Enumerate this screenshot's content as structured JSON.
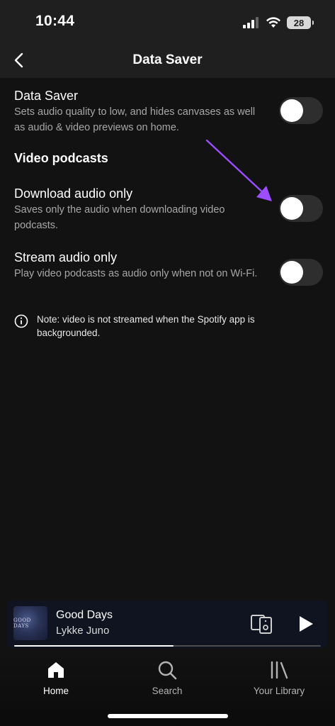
{
  "status_bar": {
    "time": "10:44",
    "battery": "28"
  },
  "header": {
    "title": "Data Saver",
    "back_icon": "chevron-left-icon"
  },
  "settings": [
    {
      "title": "Data Saver",
      "description": "Sets audio quality to low, and hides canvases as well as audio & video previews on home.",
      "enabled": false
    }
  ],
  "video_podcasts": {
    "heading": "Video podcasts",
    "items": [
      {
        "title": "Download audio only",
        "description": "Saves only the audio when downloading video podcasts.",
        "enabled": false
      },
      {
        "title": "Stream audio only",
        "description": "Play video podcasts as audio only when not on Wi-Fi.",
        "enabled": false
      }
    ]
  },
  "note": {
    "icon": "info-icon",
    "text": "Note: video is not streamed when the Spotify app is backgrounded."
  },
  "annotation": {
    "color": "#9b4dff"
  },
  "mini_player": {
    "track_title": "Good Days",
    "artist": "Lykke Juno",
    "album_art_text": "GOOD DAYS",
    "progress": 0.52
  },
  "bottom_nav": {
    "items": [
      {
        "label": "Home",
        "icon": "home-icon",
        "active": true
      },
      {
        "label": "Search",
        "icon": "search-icon",
        "active": false
      },
      {
        "label": "Your Library",
        "icon": "library-icon",
        "active": false
      }
    ]
  },
  "colors": {
    "background": "#121212",
    "header": "#1f1f1f",
    "toggle_off": "#2e2e2e",
    "secondary_text": "#a7a7a7"
  }
}
